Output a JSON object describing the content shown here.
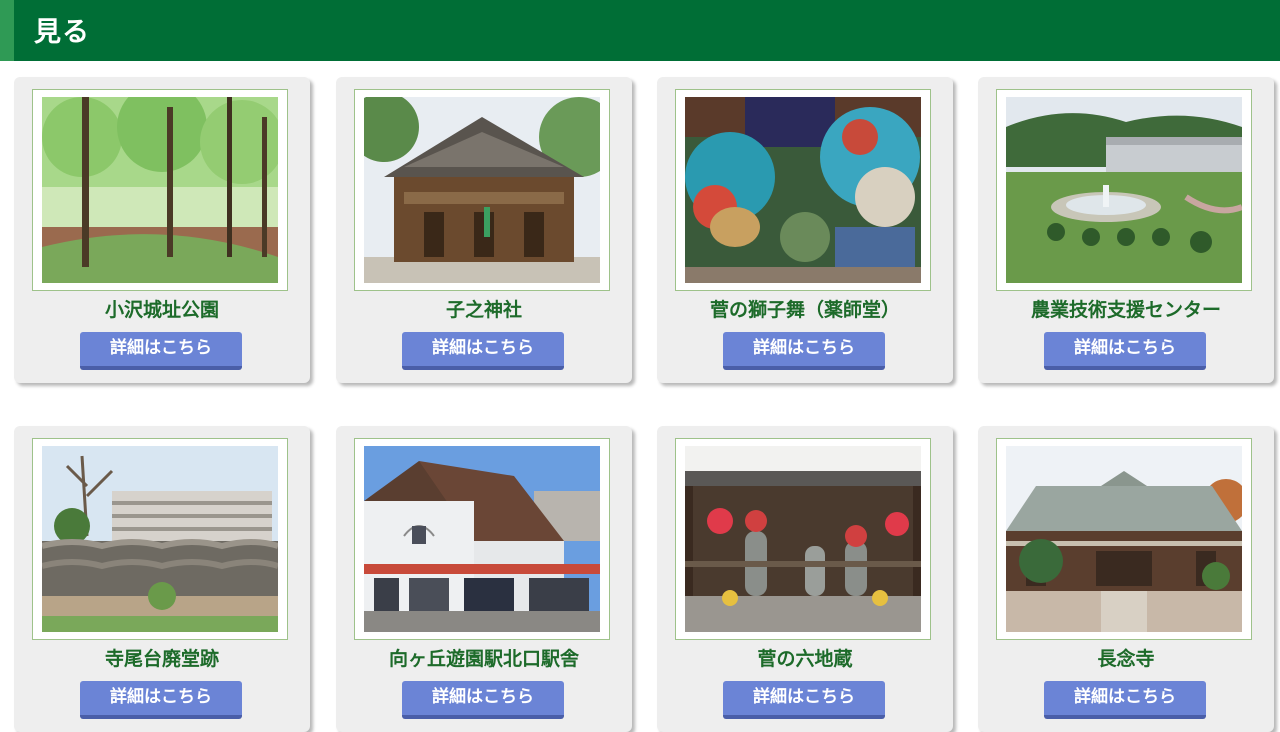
{
  "header": {
    "title": "見る"
  },
  "cards": [
    {
      "title": "小沢城址公園",
      "button_label": "詳細はこちら",
      "image": "forest-park-photo"
    },
    {
      "title": "子之神社",
      "button_label": "詳細はこちら",
      "image": "shrine-photo"
    },
    {
      "title": "菅の獅子舞（薬師堂）",
      "button_label": "詳細はこちら",
      "image": "lion-dance-photo"
    },
    {
      "title": "農業技術支援センター",
      "button_label": "詳細はこちら",
      "image": "greenhouse-garden-photo"
    },
    {
      "title": "寺尾台廃堂跡",
      "button_label": "詳細はこちら",
      "image": "stone-wall-ruins-photo"
    },
    {
      "title": "向ヶ丘遊園駅北口駅舎",
      "button_label": "詳細はこちら",
      "image": "station-building-photo"
    },
    {
      "title": "菅の六地蔵",
      "button_label": "詳細はこちら",
      "image": "jizo-statues-photo"
    },
    {
      "title": "長念寺",
      "button_label": "詳細はこちら",
      "image": "temple-photo"
    }
  ],
  "colors": {
    "header_bg": "#006e36",
    "title_text": "#1d6b2a",
    "button_bg": "#6b84d6"
  }
}
